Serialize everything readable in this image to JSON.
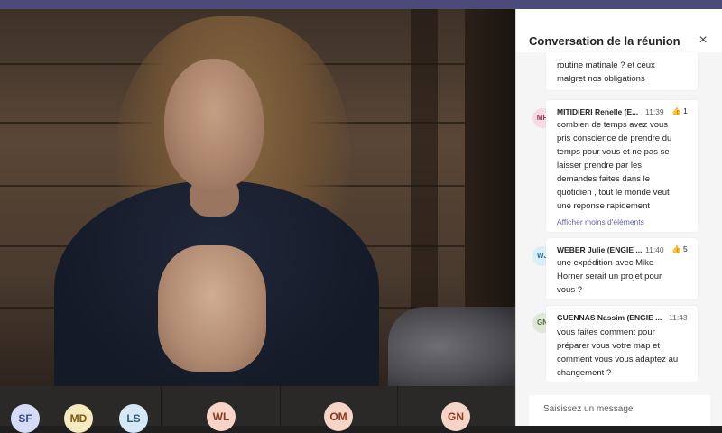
{
  "chat": {
    "title": "Conversation de la réunion",
    "close_icon": "×",
    "partial_message": {
      "lines": [
        "routine matinale ? et ceux",
        "malgret nos obligations"
      ]
    },
    "messages": [
      {
        "initials": "MR",
        "author": "MITIDIERI Renelle (E...",
        "time": "11:39",
        "reaction_count": "1",
        "lines": [
          "combien de temps avez vous",
          "pris conscience de prendre du",
          "temps pour vous et ne pas se",
          "laisser prendre par les",
          "demandes faites dans le",
          "quotidien , tout le monde veut",
          "une reponse rapidement"
        ],
        "show_less": "Afficher moins d'éléments",
        "avatar_bg": "#f6dbe4",
        "avatar_fg": "#9b3b5a"
      },
      {
        "initials": "WJ",
        "author": "WEBER Julie (ENGIE ...",
        "time": "11:40",
        "reaction_count": "5",
        "lines": [
          "une expédition avec Mike",
          "Horner serait un projet pour",
          "vous ?"
        ],
        "avatar_bg": "#d9eef7",
        "avatar_fg": "#2a6d8f"
      },
      {
        "initials": "GN",
        "author": "GUENNAS Nassim (ENGIE ...",
        "time": "11:43",
        "lines": [
          "vous faites comment pour",
          "préparer vous votre map et",
          "comment vous vous adaptez au",
          "changement ?"
        ],
        "avatar_bg": "#dfe8d7",
        "avatar_fg": "#4d6a3a"
      }
    ],
    "compose_placeholder": "Saisissez un message"
  },
  "participants": [
    {
      "initials": "SF",
      "bg": "#d6dcf5",
      "fg": "#3b4a8a"
    },
    {
      "initials": "MD",
      "bg": "#f6eac0",
      "fg": "#7a5a10"
    },
    {
      "initials": "LS",
      "bg": "#d6e8f5",
      "fg": "#2e5b7d"
    },
    {
      "initials": "WL",
      "bg": "#f7d4c8",
      "fg": "#8a3b22"
    },
    {
      "initials": "OM",
      "bg": "#f7d4c8",
      "fg": "#8a3b22"
    },
    {
      "initials": "GN",
      "bg": "#f7d4c8",
      "fg": "#8a3b22"
    }
  ],
  "icons": {
    "close": "close-icon",
    "reaction": "thumbs-up-icon"
  }
}
